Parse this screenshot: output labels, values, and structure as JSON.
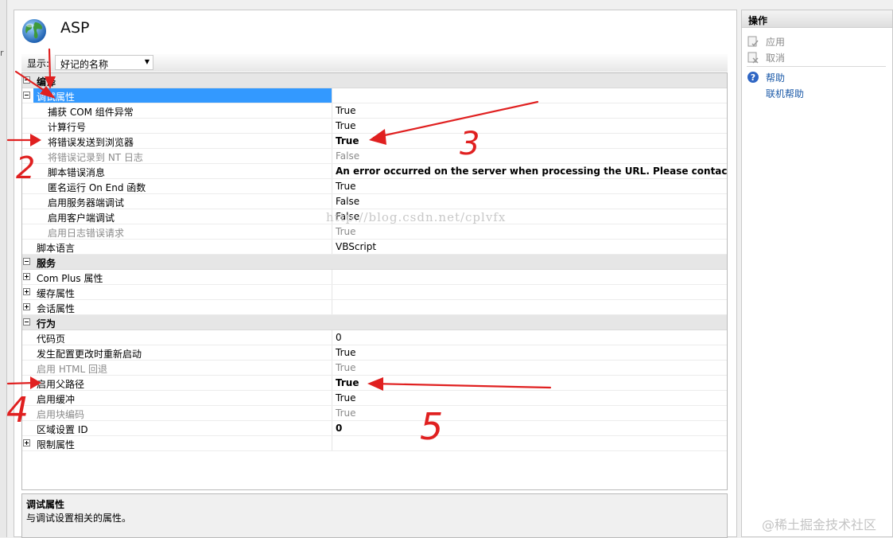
{
  "window": {
    "title": "ASP"
  },
  "toolbar": {
    "show_label": "显示:",
    "display_value": "好记的名称"
  },
  "grid": {
    "rows": [
      {
        "type": "category",
        "name": "编译",
        "expanded": true
      },
      {
        "type": "group",
        "name": "调试属性",
        "expanded": true,
        "selected": true
      },
      {
        "type": "prop",
        "level": 2,
        "name": "捕获 COM 组件异常",
        "value": "True"
      },
      {
        "type": "prop",
        "level": 2,
        "name": "计算行号",
        "value": "True"
      },
      {
        "type": "prop",
        "level": 2,
        "name": "将错误发送到浏览器",
        "value": "True",
        "bold": true
      },
      {
        "type": "prop",
        "level": 2,
        "name": "将错误记录到 NT 日志",
        "value": "False",
        "dim": true
      },
      {
        "type": "prop",
        "level": 2,
        "name": "脚本错误消息",
        "value": "An error occurred on the server when processing the URL. Please contact the sys",
        "bold": true
      },
      {
        "type": "prop",
        "level": 2,
        "name": "匿名运行 On End 函数",
        "value": "True"
      },
      {
        "type": "prop",
        "level": 2,
        "name": "启用服务器端调试",
        "value": "False"
      },
      {
        "type": "prop",
        "level": 2,
        "name": "启用客户端调试",
        "value": "False"
      },
      {
        "type": "prop",
        "level": 2,
        "name": "启用日志错误请求",
        "value": "True",
        "dim": true
      },
      {
        "type": "prop",
        "level": 1,
        "name": "脚本语言",
        "value": "VBScript"
      },
      {
        "type": "category",
        "name": "服务",
        "expanded": true
      },
      {
        "type": "group",
        "name": "Com Plus 属性",
        "expanded": false
      },
      {
        "type": "group",
        "name": "缓存属性",
        "expanded": false
      },
      {
        "type": "group",
        "name": "会话属性",
        "expanded": false
      },
      {
        "type": "category",
        "name": "行为",
        "expanded": true
      },
      {
        "type": "prop",
        "level": 1,
        "name": "代码页",
        "value": "0"
      },
      {
        "type": "prop",
        "level": 1,
        "name": "发生配置更改时重新启动",
        "value": "True"
      },
      {
        "type": "prop",
        "level": 1,
        "name": "启用 HTML 回退",
        "value": "True",
        "dim": true
      },
      {
        "type": "prop",
        "level": 1,
        "name": "启用父路径",
        "value": "True",
        "bold": true
      },
      {
        "type": "prop",
        "level": 1,
        "name": "启用缓冲",
        "value": "True"
      },
      {
        "type": "prop",
        "level": 1,
        "name": "启用块编码",
        "value": "True",
        "dim": true
      },
      {
        "type": "prop",
        "level": 1,
        "name": "区域设置 ID",
        "value": "0",
        "bold": true
      },
      {
        "type": "group",
        "name": "限制属性",
        "expanded": false
      }
    ]
  },
  "watermark": "http://blog.csdn.net/cplvfx",
  "description": {
    "title": "调试属性",
    "text": "与调试设置相关的属性。"
  },
  "actions": {
    "header": "操作",
    "apply": "应用",
    "cancel": "取消",
    "help": "帮助",
    "online_help": "联机帮助"
  },
  "site_watermark": "@稀土掘金技术社区",
  "annotations": {
    "two": "2",
    "three": "3",
    "four": "4",
    "five": "5"
  },
  "colors": {
    "selection": "#3399ff",
    "annotation": "#e02020",
    "link": "#1c5aa8"
  }
}
